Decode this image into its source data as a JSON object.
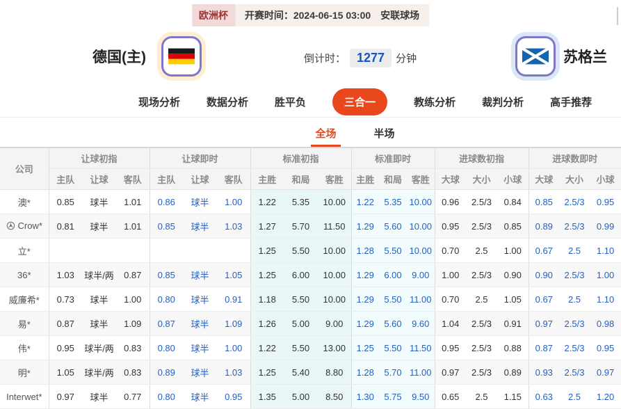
{
  "colors": {
    "accent": "#e8481c",
    "odds-blue": "#2260c8",
    "countdown-blue": "#1553c8",
    "std-init-bg": "#e9f7f7",
    "std-live-bg": "#f3fcfc",
    "league-badge-bg": "#f2dada",
    "league-badge-text": "#a03333",
    "strip-bg": "#f7efec",
    "home-glow": "#fdeed2",
    "away-glow": "#d9e7f7",
    "flag-border": "#8276cb"
  },
  "match_strip": {
    "league": "欧洲杯",
    "kickoff": "开赛时间：2024-06-15 03:00",
    "venue": "安联球场"
  },
  "teams": {
    "home_name": "德国(主)",
    "away_name": "苏格兰",
    "countdown_label": "倒计时：",
    "countdown_value": "1277",
    "countdown_unit": "分钟"
  },
  "nav": {
    "tabs": [
      {
        "id": "live-analysis",
        "label": "现场分析",
        "active": false
      },
      {
        "id": "data-analysis",
        "label": "数据分析",
        "active": false
      },
      {
        "id": "win-draw-lose",
        "label": "胜平负",
        "active": false
      },
      {
        "id": "three-in-one",
        "label": "三合一",
        "active": true
      },
      {
        "id": "coach-analysis",
        "label": "教练分析",
        "active": false
      },
      {
        "id": "referee-analysis",
        "label": "裁判分析",
        "active": false
      },
      {
        "id": "expert-picks",
        "label": "高手推荐",
        "active": false
      }
    ]
  },
  "sub_tabs": {
    "tabs": [
      {
        "id": "full-match",
        "label": "全场",
        "active": true
      },
      {
        "id": "half-match",
        "label": "半场",
        "active": false
      }
    ]
  },
  "table": {
    "company_header": "公司",
    "groups": [
      {
        "label": "让球初指",
        "cols": [
          "主队",
          "让球",
          "客队"
        ]
      },
      {
        "label": "让球即时",
        "cols": [
          "主队",
          "让球",
          "客队"
        ]
      },
      {
        "label": "标准初指",
        "cols": [
          "主胜",
          "和局",
          "客胜"
        ]
      },
      {
        "label": "标准即时",
        "cols": [
          "主胜",
          "和局",
          "客胜"
        ]
      },
      {
        "label": "进球数初指",
        "cols": [
          "大球",
          "大小",
          "小球"
        ]
      },
      {
        "label": "进球数即时",
        "cols": [
          "大球",
          "大小",
          "小球"
        ]
      }
    ],
    "rows": [
      {
        "company": "澳*",
        "icon": null,
        "cells": [
          "0.85",
          "球半",
          "1.01",
          "0.86",
          "球半",
          "1.00",
          "1.22",
          "5.35",
          "10.00",
          "1.22",
          "5.35",
          "10.00",
          "0.96",
          "2.5/3",
          "0.84",
          "0.85",
          "2.5/3",
          "0.95"
        ]
      },
      {
        "company": "Crow*",
        "icon": "soccer-ball-icon",
        "cells": [
          "0.81",
          "球半",
          "1.01",
          "0.85",
          "球半",
          "1.03",
          "1.27",
          "5.70",
          "11.50",
          "1.29",
          "5.60",
          "10.00",
          "0.95",
          "2.5/3",
          "0.85",
          "0.89",
          "2.5/3",
          "0.99"
        ]
      },
      {
        "company": "立*",
        "icon": null,
        "cells": [
          "",
          "",
          "",
          "",
          "",
          "",
          "1.25",
          "5.50",
          "10.00",
          "1.28",
          "5.50",
          "10.00",
          "0.70",
          "2.5",
          "1.00",
          "0.67",
          "2.5",
          "1.10"
        ]
      },
      {
        "company": "36*",
        "icon": null,
        "cells": [
          "1.03",
          "球半/两",
          "0.87",
          "0.85",
          "球半",
          "1.05",
          "1.25",
          "6.00",
          "10.00",
          "1.29",
          "6.00",
          "9.00",
          "1.00",
          "2.5/3",
          "0.90",
          "0.90",
          "2.5/3",
          "1.00"
        ]
      },
      {
        "company": "威廉希*",
        "icon": null,
        "cells": [
          "0.73",
          "球半",
          "1.00",
          "0.80",
          "球半",
          "0.91",
          "1.18",
          "5.50",
          "10.00",
          "1.29",
          "5.50",
          "11.00",
          "0.70",
          "2.5",
          "1.05",
          "0.67",
          "2.5",
          "1.10"
        ]
      },
      {
        "company": "易*",
        "icon": null,
        "cells": [
          "0.87",
          "球半",
          "1.09",
          "0.87",
          "球半",
          "1.09",
          "1.26",
          "5.00",
          "9.00",
          "1.29",
          "5.60",
          "9.60",
          "1.04",
          "2.5/3",
          "0.91",
          "0.97",
          "2.5/3",
          "0.98"
        ]
      },
      {
        "company": "伟*",
        "icon": null,
        "cells": [
          "0.95",
          "球半/两",
          "0.83",
          "0.80",
          "球半",
          "1.00",
          "1.22",
          "5.50",
          "13.00",
          "1.25",
          "5.50",
          "11.50",
          "0.95",
          "2.5/3",
          "0.88",
          "0.87",
          "2.5/3",
          "0.95"
        ]
      },
      {
        "company": "明*",
        "icon": null,
        "cells": [
          "1.05",
          "球半/两",
          "0.83",
          "0.89",
          "球半",
          "1.03",
          "1.25",
          "5.40",
          "8.80",
          "1.28",
          "5.70",
          "11.00",
          "0.97",
          "2.5/3",
          "0.89",
          "0.93",
          "2.5/3",
          "0.97"
        ]
      },
      {
        "company": "Interwet*",
        "icon": null,
        "cells": [
          "0.97",
          "球半",
          "0.77",
          "0.80",
          "球半",
          "0.95",
          "1.35",
          "5.00",
          "8.50",
          "1.30",
          "5.75",
          "9.50",
          "0.65",
          "2.5",
          "1.15",
          "0.63",
          "2.5",
          "1.20"
        ]
      }
    ]
  }
}
